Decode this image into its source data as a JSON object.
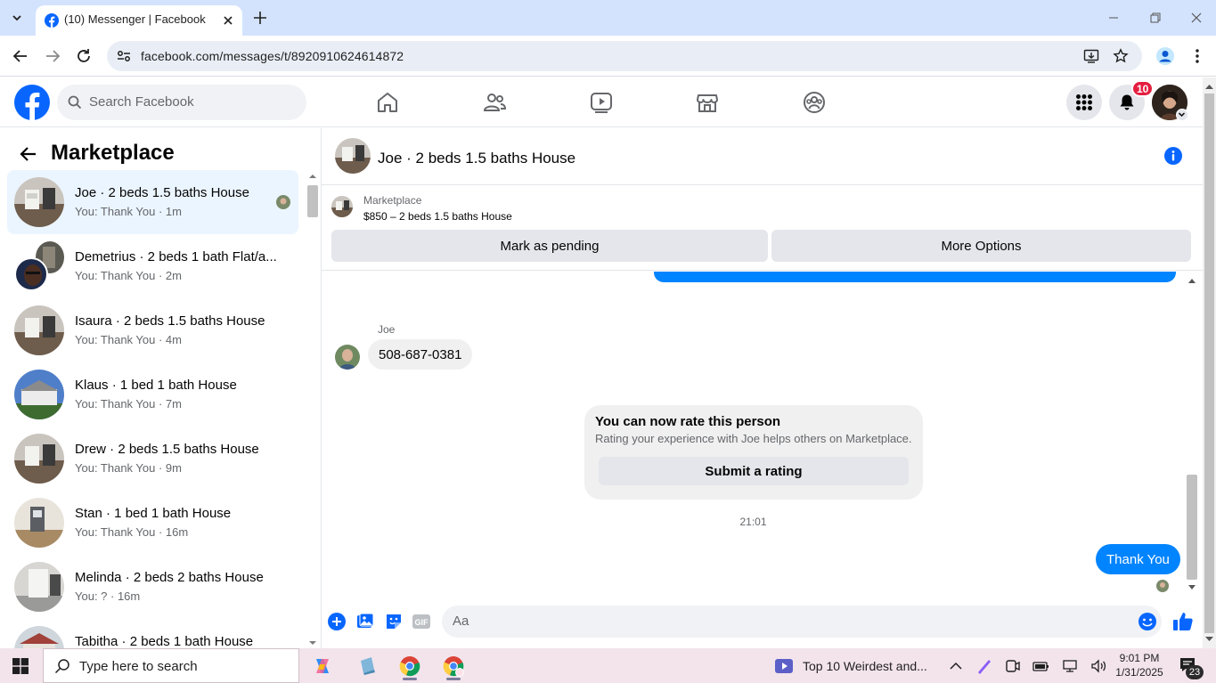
{
  "browser": {
    "tab_title": "(10) Messenger | Facebook",
    "url": "facebook.com/messages/t/8920910624614872"
  },
  "fb_header": {
    "search_placeholder": "Search Facebook",
    "notification_count": "10",
    "nav_icons": [
      "home-icon",
      "friends-icon",
      "video-icon",
      "marketplace-icon",
      "groups-icon"
    ]
  },
  "sidebar": {
    "title": "Marketplace",
    "conversations": [
      {
        "name": "Joe · 2 beds 1.5 baths House",
        "subtitle": "You: Thank You · 1m",
        "active": true
      },
      {
        "name": "Demetrius · 2 beds 1 bath Flat/a...",
        "subtitle": "You: Thank You · 2m"
      },
      {
        "name": "Isaura · 2 beds 1.5 baths House",
        "subtitle": "You: Thank You · 4m"
      },
      {
        "name": "Klaus · 1 bed 1 bath House",
        "subtitle": "You: Thank You · 7m"
      },
      {
        "name": "Drew · 2 beds 1.5 baths House",
        "subtitle": "You: Thank You · 9m"
      },
      {
        "name": "Stan · 1 bed 1 bath House",
        "subtitle": "You: Thank You · 16m"
      },
      {
        "name": "Melinda · 2 beds 2 baths House",
        "subtitle": "You: ? · 16m"
      },
      {
        "name": "Tabitha · 2 beds 1 bath House",
        "subtitle": ""
      }
    ]
  },
  "conversation": {
    "title": "Joe · 2 beds 1.5 baths House",
    "listing": {
      "category": "Marketplace",
      "price_title": "$850 – 2 beds 1.5 baths House",
      "mark_pending_label": "Mark as pending",
      "more_options_label": "More Options"
    },
    "messages": {
      "sender_name": "Joe",
      "received_text": "508-687-0381",
      "rating_card": {
        "title": "You can now rate this person",
        "description": "Rating your experience with Joe helps others on Marketplace.",
        "button_label": "Submit a rating"
      },
      "timestamp": "21:01",
      "sent_text": "Thank You"
    },
    "composer_placeholder": "Aa"
  },
  "taskbar": {
    "search_placeholder": "Type here to search",
    "news_text": "Top 10 Weirdest and...",
    "clock_time": "9:01 PM",
    "clock_date": "1/31/2025",
    "notification_count": "23"
  },
  "colors": {
    "fb_blue": "#0866ff",
    "messenger_blue": "#0084ff",
    "badge_red": "#e41e3f"
  }
}
